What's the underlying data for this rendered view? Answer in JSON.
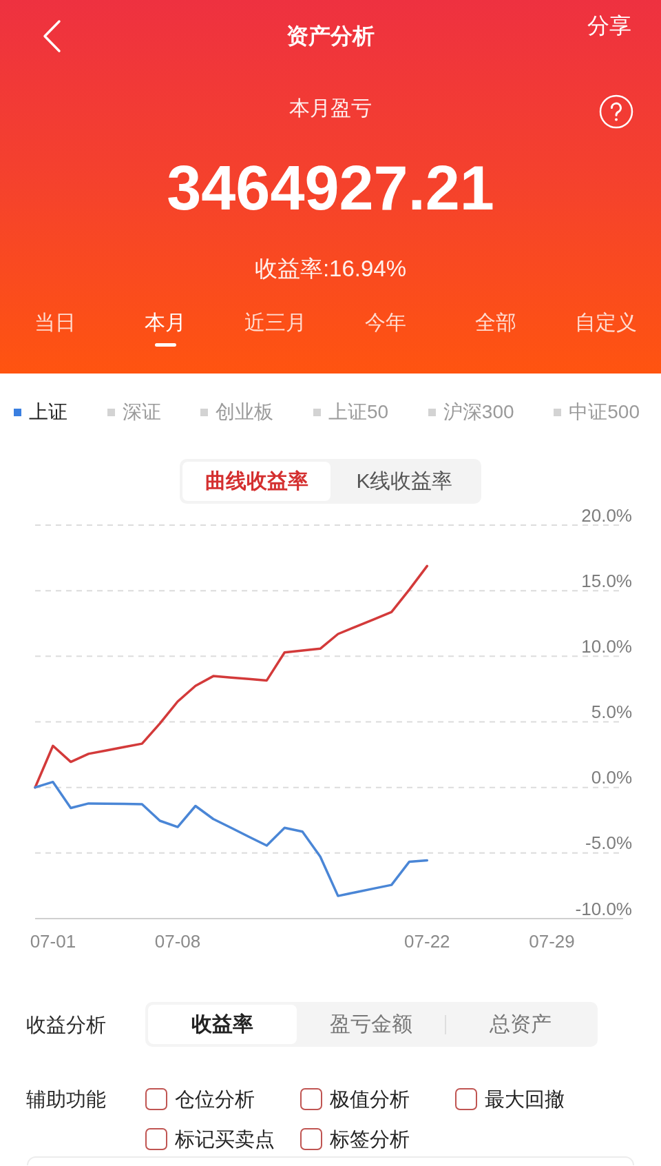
{
  "nav": {
    "title": "资产分析",
    "share": "分享"
  },
  "summary": {
    "label": "本月盈亏",
    "amount": "3464927.21",
    "return_rate": "收益率:16.94%"
  },
  "periods": [
    {
      "label": "当日",
      "selected": false
    },
    {
      "label": "本月",
      "selected": true
    },
    {
      "label": "近三月",
      "selected": false
    },
    {
      "label": "今年",
      "selected": false
    },
    {
      "label": "全部",
      "selected": false
    },
    {
      "label": "自定义",
      "selected": false
    }
  ],
  "benchmarks": [
    {
      "label": "上证",
      "selected": true
    },
    {
      "label": "深证",
      "selected": false
    },
    {
      "label": "创业板",
      "selected": false
    },
    {
      "label": "上证50",
      "selected": false
    },
    {
      "label": "沪深300",
      "selected": false
    },
    {
      "label": "中证500",
      "selected": false
    }
  ],
  "chart_modes": [
    {
      "label": "曲线收益率",
      "selected": true
    },
    {
      "label": "K线收益率",
      "selected": false
    }
  ],
  "chart": {
    "chart_data": {
      "type": "line",
      "grid": true,
      "categories": [
        null,
        "07-01",
        null,
        null,
        null,
        null,
        null,
        null,
        "07-08",
        null,
        null,
        null,
        null,
        null,
        null,
        null,
        null,
        null,
        null,
        null,
        null,
        null,
        "07-22",
        null,
        null,
        null,
        null,
        null,
        null,
        "07-29",
        null,
        null,
        null,
        null
      ],
      "ylim": [
        -10,
        20
      ],
      "yticks": [
        {
          "value": 20,
          "label": "20.0%"
        },
        {
          "value": 15,
          "label": "15.0%"
        },
        {
          "value": 10,
          "label": "10.0%"
        },
        {
          "value": 5,
          "label": "5.0%"
        },
        {
          "value": 0,
          "label": "0.0%"
        },
        {
          "value": -5,
          "label": "-5.0%"
        },
        {
          "value": -10,
          "label": "-10.0%"
        }
      ],
      "series": [
        {
          "color": "#d33a3a",
          "values": [
            0,
            3.17,
            1.95,
            2.56,
            2.82,
            3.08,
            3.34,
            4.88,
            6.55,
            7.75,
            8.49,
            8.38,
            8.27,
            8.16,
            10.29,
            10.44,
            10.58,
            11.7,
            12.26,
            12.81,
            13.37,
            15.08,
            16.88,
            null,
            null,
            null,
            null,
            null,
            null,
            null,
            null,
            null,
            null,
            null
          ]
        },
        {
          "color": "#4a86d6",
          "values": [
            0,
            0.42,
            -1.57,
            -1.22,
            -1.24,
            -1.26,
            -1.28,
            -2.54,
            -3.02,
            -1.41,
            -2.41,
            -3.08,
            -3.76,
            -4.43,
            -3.08,
            -3.37,
            -5.27,
            -8.27,
            -7.99,
            -7.71,
            -7.43,
            -5.66,
            -5.56,
            null,
            null,
            null,
            null,
            null,
            null,
            null,
            null,
            null,
            null,
            null
          ]
        }
      ]
    }
  },
  "analysis": {
    "label": "收益分析",
    "options": [
      {
        "label": "收益率",
        "selected": true
      },
      {
        "label": "盈亏金额",
        "selected": false
      },
      {
        "label": "总资产",
        "selected": false
      }
    ]
  },
  "assist": {
    "label": "辅助功能",
    "options": [
      {
        "label": "仓位分析",
        "checked": false
      },
      {
        "label": "极值分析",
        "checked": false
      },
      {
        "label": "最大回撤",
        "checked": false
      },
      {
        "label": "标记买卖点",
        "checked": false
      },
      {
        "label": "标签分析",
        "checked": false
      }
    ]
  }
}
